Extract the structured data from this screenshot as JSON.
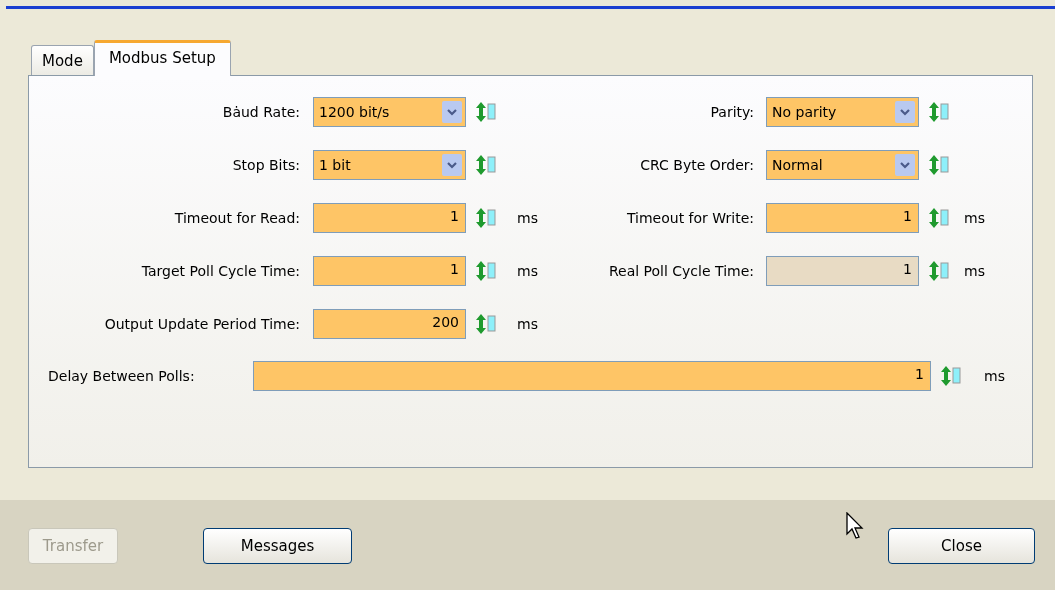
{
  "tabs": [
    {
      "label": "Mode",
      "selected": false
    },
    {
      "label": "Modbus Setup",
      "selected": true
    }
  ],
  "rows": [
    {
      "left": {
        "label": "Bȧud Rate:",
        "kind": "combo",
        "value": "1200 bit/s"
      },
      "right": {
        "label": "Parity:",
        "kind": "combo",
        "value": "No parity"
      }
    },
    {
      "left": {
        "label": "Stop Bits:",
        "kind": "combo",
        "value": "1 bit"
      },
      "right": {
        "label": "CRC Byte Order:",
        "kind": "combo",
        "value": "Normal"
      }
    },
    {
      "left": {
        "label": "Timeout for Read:",
        "kind": "number",
        "value": "1",
        "unit": "ms",
        "readonly": false
      },
      "right": {
        "label": "Timeout for Write:",
        "kind": "number",
        "value": "1",
        "unit": "ms",
        "readonly": false
      }
    },
    {
      "left": {
        "label": "Target Poll Cycle Time:",
        "kind": "number",
        "value": "1",
        "unit": "ms",
        "readonly": false
      },
      "right": {
        "label": "Real Poll Cycle Time:",
        "kind": "number",
        "value": "1",
        "unit": "ms",
        "readonly": true
      }
    },
    {
      "left": {
        "label": "Output Update Period Time:",
        "kind": "number",
        "value": "200",
        "unit": "ms",
        "readonly": false
      }
    }
  ],
  "wide": {
    "label": "Delay Between Polls:",
    "value": "1",
    "unit": "ms",
    "readonly": false
  },
  "buttons": [
    {
      "label": "Transfer",
      "disabled": true
    },
    {
      "label": "Messages",
      "disabled": false
    }
  ],
  "close_button": {
    "label": "Close",
    "disabled": false
  }
}
